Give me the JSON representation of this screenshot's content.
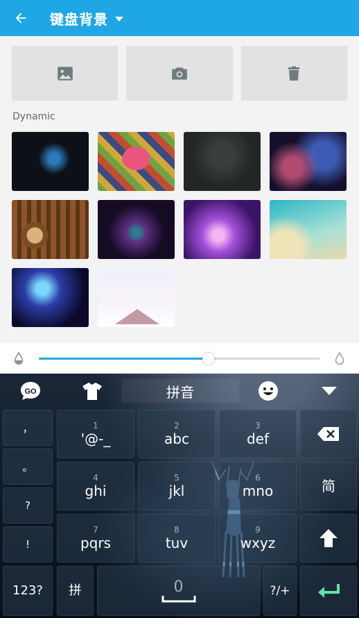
{
  "appbar": {
    "title": "键盘背景"
  },
  "section": {
    "label": "Dynamic"
  },
  "thumbnails": [
    1,
    2,
    3,
    4,
    5,
    6,
    7,
    8,
    9,
    10
  ],
  "slider": {
    "value_fraction": 0.6
  },
  "keyboard": {
    "go_label": "GO",
    "mode_label": "拼音",
    "punct_keys": [
      "，",
      "。",
      "?",
      "!"
    ],
    "keys": [
      {
        "num": "1",
        "main": "'@-_"
      },
      {
        "num": "2",
        "main": "abc"
      },
      {
        "num": "3",
        "main": "def"
      },
      {
        "num": "4",
        "main": "ghi"
      },
      {
        "num": "5",
        "main": "jkl"
      },
      {
        "num": "6",
        "main": "mno"
      },
      {
        "num": "7",
        "main": "pqrs"
      },
      {
        "num": "8",
        "main": "tuv"
      },
      {
        "num": "9",
        "main": "wxyz"
      }
    ],
    "simplified_label": "简",
    "num_key": "123?",
    "pin_key": "拼",
    "space_num": "0",
    "symbol_key": "?/+"
  },
  "colors": {
    "accent": "#1ea7e4",
    "enter": "#5fe3a9"
  }
}
